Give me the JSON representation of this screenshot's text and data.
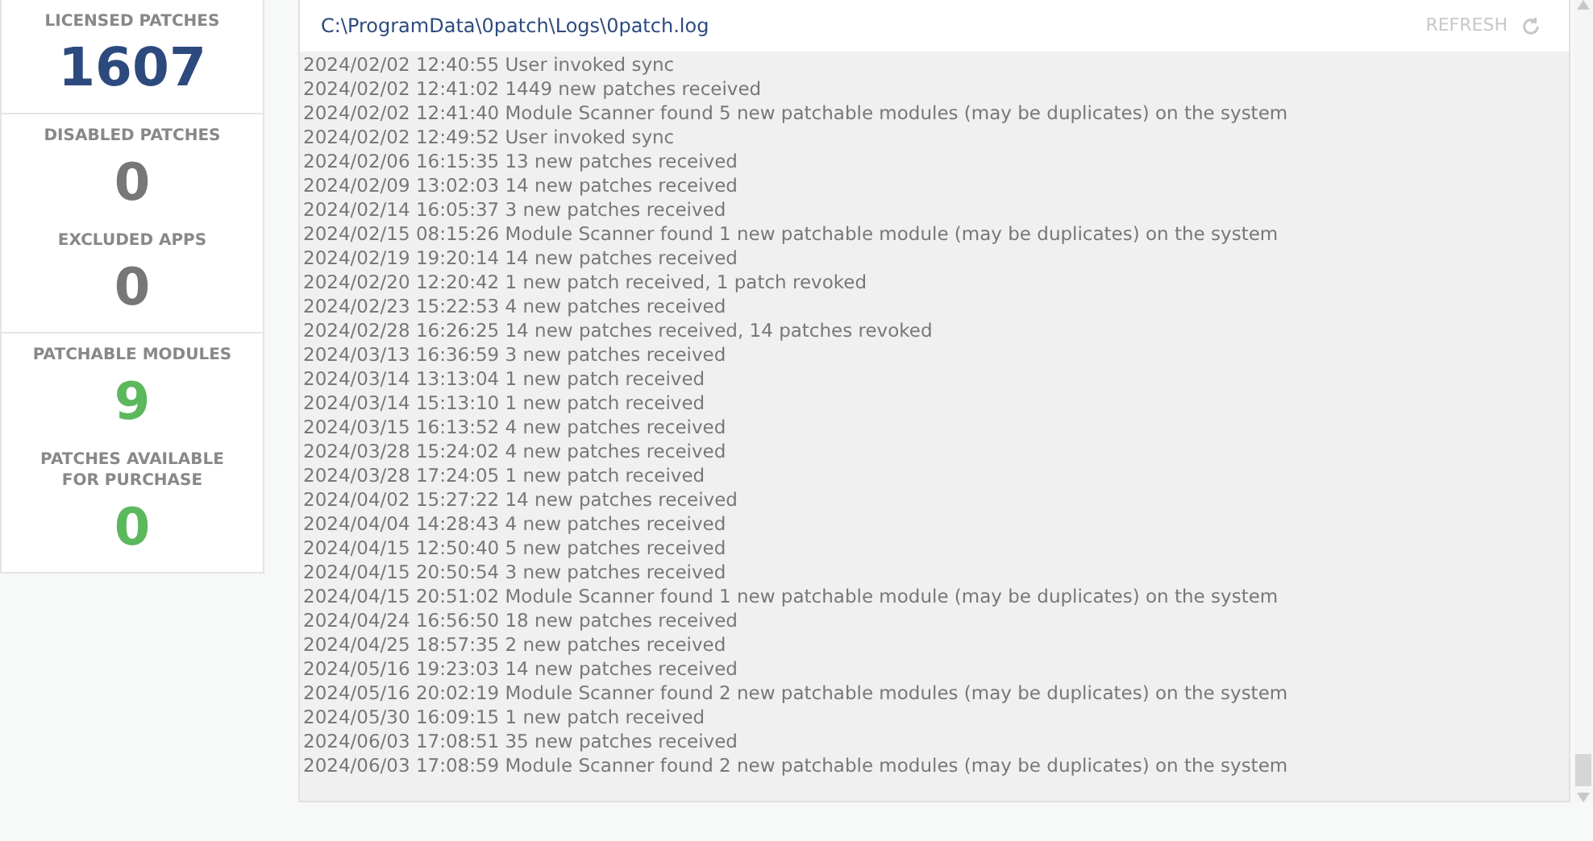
{
  "stat_cards": [
    {
      "stats": [
        {
          "label": "LICENSED PATCHES",
          "value": "1607",
          "kind": "primary"
        }
      ]
    },
    {
      "stats": [
        {
          "label": "DISABLED PATCHES",
          "value": "0",
          "kind": "neutral"
        },
        {
          "label": "EXCLUDED APPS",
          "value": "0",
          "kind": "neutral"
        }
      ]
    },
    {
      "stats": [
        {
          "label": "PATCHABLE MODULES",
          "value": "9",
          "kind": "positive"
        },
        {
          "label": "PATCHES AVAILABLE FOR PURCHASE",
          "value": "0",
          "kind": "positive"
        }
      ]
    }
  ],
  "log_panel": {
    "path": "C:\\ProgramData\\0patch\\Logs\\0patch.log",
    "refresh_label": "REFRESH",
    "lines": [
      "2024/02/02 12:40:55 User invoked sync",
      "2024/02/02 12:41:02 1449 new patches received",
      "2024/02/02 12:41:40 Module Scanner found 5 new patchable modules (may be duplicates) on the system",
      "2024/02/02 12:49:52 User invoked sync",
      "2024/02/06 16:15:35 13 new patches received",
      "2024/02/09 13:02:03 14 new patches received",
      "2024/02/14 16:05:37 3 new patches received",
      "2024/02/15 08:15:26 Module Scanner found 1 new patchable module (may be duplicates) on the system",
      "2024/02/19 19:20:14 14 new patches received",
      "2024/02/20 12:20:42 1 new patch received, 1 patch revoked",
      "2024/02/23 15:22:53 4 new patches received",
      "2024/02/28 16:26:25 14 new patches received, 14 patches revoked",
      "2024/03/13 16:36:59 3 new patches received",
      "2024/03/14 13:13:04 1 new patch received",
      "2024/03/14 15:13:10 1 new patch received",
      "2024/03/15 16:13:52 4 new patches received",
      "2024/03/28 15:24:02 4 new patches received",
      "2024/03/28 17:24:05 1 new patch received",
      "2024/04/02 15:27:22 14 new patches received",
      "2024/04/04 14:28:43 4 new patches received",
      "2024/04/15 12:50:40 5 new patches received",
      "2024/04/15 20:50:54 3 new patches received",
      "2024/04/15 20:51:02 Module Scanner found 1 new patchable module (may be duplicates) on the system",
      "2024/04/24 16:56:50 18 new patches received",
      "2024/04/25 18:57:35 2 new patches received",
      "2024/05/16 19:23:03 14 new patches received",
      "2024/05/16 20:02:19 Module Scanner found 2 new patchable modules (may be duplicates) on the system",
      "2024/05/30 16:09:15 1 new patch received",
      "2024/06/03 17:08:51 35 new patches received",
      "2024/06/03 17:08:59 Module Scanner found 2 new patchable modules (may be duplicates) on the system"
    ]
  }
}
